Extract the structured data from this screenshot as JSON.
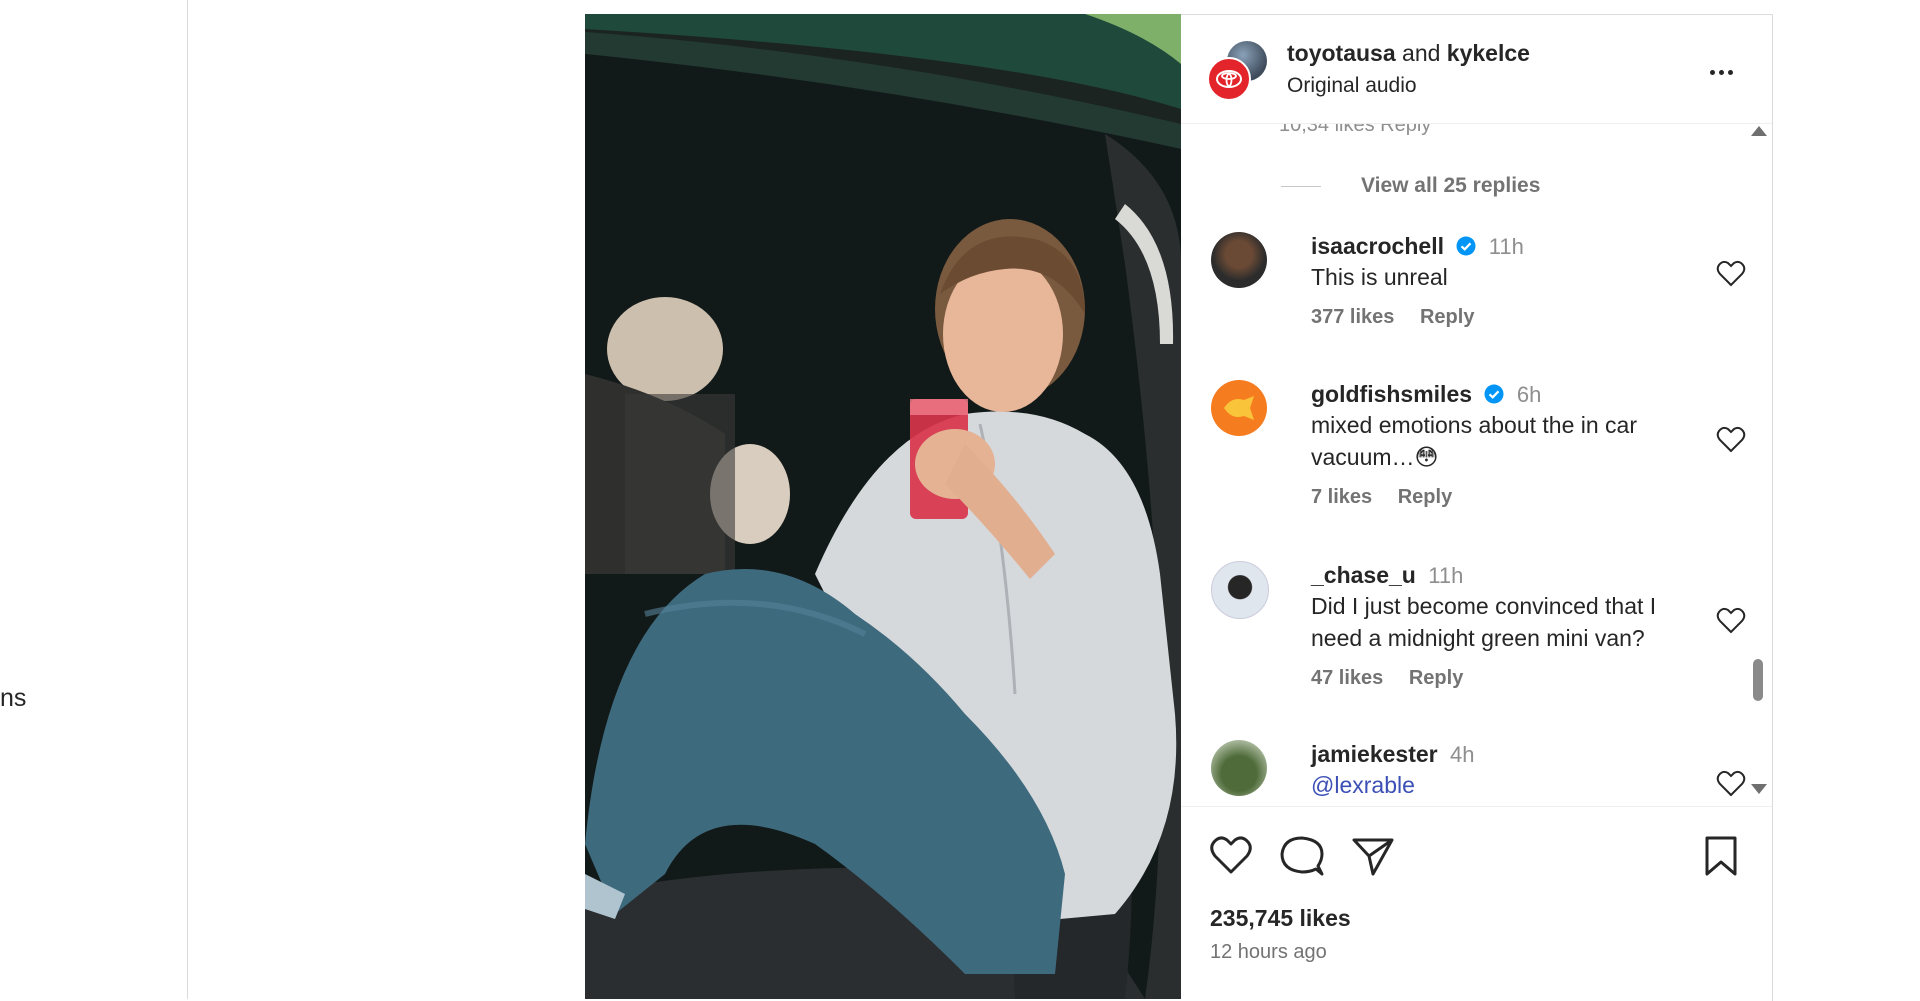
{
  "sidebar": {
    "partial_label": "ns"
  },
  "post": {
    "header": {
      "author": "toyotausa",
      "and_text": "and",
      "collaborator": "kykelce",
      "audio": "Original audio"
    },
    "comments_cut_text": "10,34 likes  Reply",
    "view_replies": "View all 25 replies",
    "comments": [
      {
        "username": "isaacrochell",
        "verified": true,
        "time": "11h",
        "text": "This is unreal",
        "likes": "377 likes",
        "reply": "Reply"
      },
      {
        "username": "goldfishsmiles",
        "verified": true,
        "time": "6h",
        "text": "mixed emotions about the in car vacuum…😳",
        "likes": "7 likes",
        "reply": "Reply"
      },
      {
        "username": "_chase_u",
        "verified": false,
        "time": "11h",
        "text": "Did I just become convinced that I need a midnight green mini van?",
        "likes": "47 likes",
        "reply": "Reply"
      },
      {
        "username": "jamiekester",
        "verified": false,
        "time": "4h",
        "text": "@lexrable",
        "likes": "",
        "reply": ""
      }
    ],
    "likes_total": "235,745 likes",
    "posted": "12 hours ago",
    "colors": {
      "verified": "#0095f6",
      "toyota_red": "#e3242b",
      "mention": "#3b4fb5"
    },
    "icons": [
      "heart-icon",
      "comment-icon",
      "share-icon",
      "bookmark-icon",
      "more-icon"
    ]
  }
}
